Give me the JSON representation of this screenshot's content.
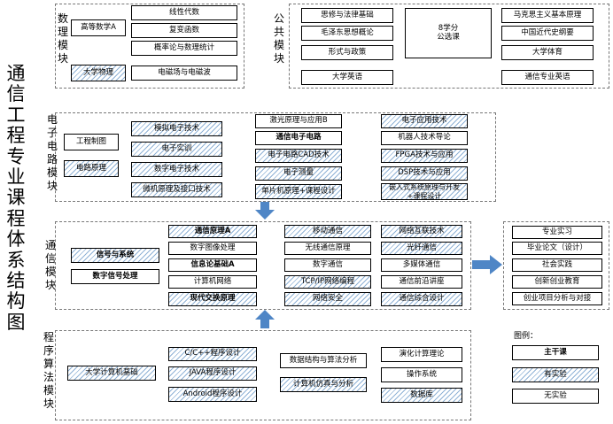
{
  "title": "通信工程专业课程体系结构图",
  "sections": {
    "math": "数理模块",
    "public": "公共模块",
    "circuit": "电子电路模块",
    "comm": "通信模块",
    "prog": "程序算法模块"
  },
  "courses": {
    "gaodeng": "高等数学A",
    "daxue_wuli": "大学物理",
    "xianxing": "线性代数",
    "fubian": "复变函数",
    "gailv": "概率论与数理统计",
    "dianci": "电磁场与电磁波",
    "sixiu": "思修与法律基础",
    "maogai": "毛泽东思想概论",
    "xingshi": "形式与政策",
    "daxue_yingyu": "大学英语",
    "gongxuan": "8学分\n公选课",
    "makesi": "马克思主义基本原理",
    "zhongguo": "中国近代史纲要",
    "tiyu": "大学体育",
    "tongxin_yingyu": "通信专业英语",
    "gongcheng_zhitu": "工程制图",
    "dianlu_yuanli": "电路原理",
    "moni": "模拟电子技术",
    "dianzi_shixun": "电子实训",
    "shuzi": "数字电子技术",
    "weiji": "微机原理及接口技术",
    "jiguang": "激光原理与应用B",
    "tongxin_dianlu": "通信电子电路",
    "cad": "电子电路CAD技术",
    "celiang": "电子测量",
    "danpianji": "单片机原理+课程设计",
    "dianzi_yingyong": "电子应用技术",
    "jiqiren": "机器人技术导论",
    "fpga": "FPGA技术与应用",
    "dsp": "DSP技术与应用",
    "qianrushi": "嵌入式系统原理与开发+课程设计",
    "xinhao": "信号与系统",
    "shuzi_xinhao": "数字信号处理",
    "tongxin_yuanli": "通信原理A",
    "tuxiang": "数字图像处理",
    "xinxilun": "信息论基础A",
    "jisuanji_wangluo": "计算机网络",
    "jiaohuan": "现代交换原理",
    "yidong": "移动通信",
    "wuxian": "无线通信原理",
    "shuzi_tongxin": "数字通信",
    "tcpip": "TCP/IP网络编程",
    "wangluo_anquan": "网络安全",
    "wangluo_hulian": "网络互联技术",
    "guangxian": "光纤通信",
    "duomeiti": "多媒体通信",
    "qianyan": "通信前沿讲座",
    "zonghe_sheji": "通信综合设计",
    "daxue_jisuanji": "大学计算机基础",
    "cpp": "C/C++程序设计",
    "java": "JAVA程序设计",
    "android": "Android程序设计",
    "shuju_jiegou": "数据结构与算法分析",
    "fangzhen": "计算机仿真与分析",
    "lianghua": "演化计算理论",
    "caozuo": "操作系统",
    "shujuku": "数据库",
    "shixi": "专业实习",
    "lunwen": "毕业论文（设计）",
    "shijian": "社会实践",
    "chuangxin": "创新创业教育",
    "chuangye": "创业项目分析与对接"
  },
  "legend": {
    "title": "图例：",
    "main": "主干课",
    "with_lab": "有实验",
    "no_lab": "无实验"
  },
  "colors": {
    "arrow": "#4f86c6",
    "hatch": "#8fb2d6",
    "border": "#000000"
  }
}
